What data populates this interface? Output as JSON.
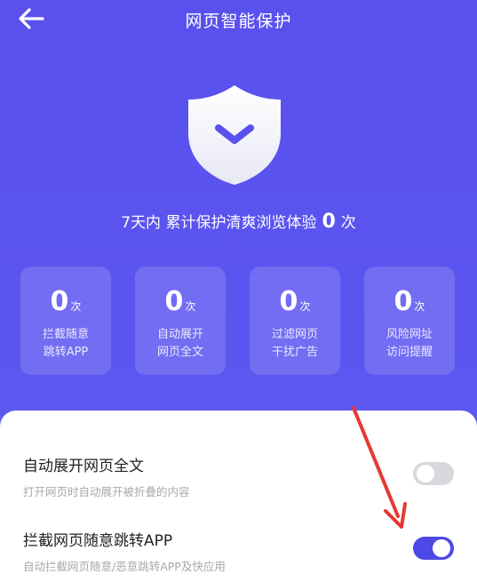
{
  "header": {
    "title": "网页智能保护",
    "back_icon": "arrow-left-icon"
  },
  "summary": {
    "prefix": "7天内  累计保护清爽浏览体验",
    "count": "0",
    "suffix": "次"
  },
  "stats": [
    {
      "value": "0",
      "unit": "次",
      "label": "拦截随意\n跳转APP"
    },
    {
      "value": "0",
      "unit": "次",
      "label": "自动展开\n网页全文"
    },
    {
      "value": "0",
      "unit": "次",
      "label": "过滤网页\n干扰广告"
    },
    {
      "value": "0",
      "unit": "次",
      "label": "风险网址\n访问提醒"
    }
  ],
  "settings": [
    {
      "title": "自动展开网页全文",
      "subtitle": "打开网页时自动展开被折叠的内容",
      "enabled": false
    },
    {
      "title": "拦截网页随意跳转APP",
      "subtitle": "自动拦截网页随意/恶意跳转APP及快应用",
      "enabled": true
    }
  ],
  "colors": {
    "accent": "#4d49e6",
    "background": "#5a50ee",
    "annotation_arrow": "#e53935"
  }
}
